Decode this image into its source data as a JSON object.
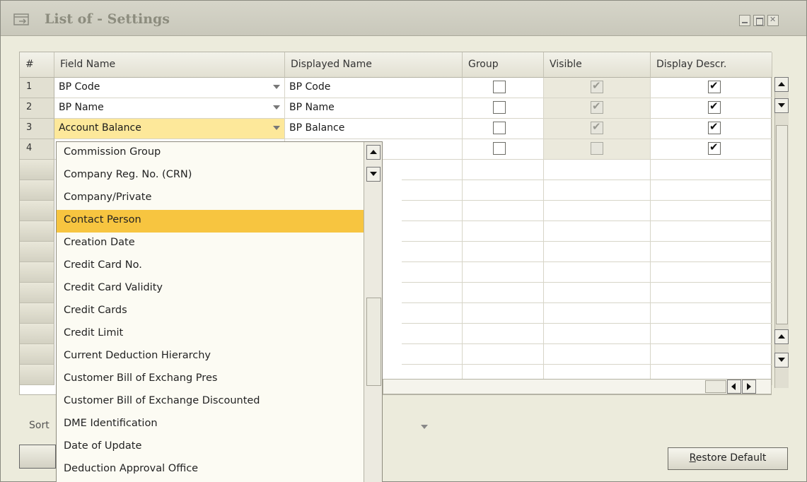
{
  "window": {
    "title": "List of - Settings"
  },
  "columns": [
    "#",
    "Field Name",
    "Displayed Name",
    "Group",
    "Visible",
    "Display Descr."
  ],
  "rows": [
    {
      "num": "1",
      "field": "BP Code",
      "displayed": "BP Code",
      "group": false,
      "visible": true,
      "descr": true
    },
    {
      "num": "2",
      "field": "BP Name",
      "displayed": "BP Name",
      "group": false,
      "visible": true,
      "descr": true
    },
    {
      "num": "3",
      "field": "Account Balance",
      "displayed": "BP Balance",
      "group": false,
      "visible": true,
      "descr": true
    },
    {
      "num": "4",
      "field": "",
      "displayed": "",
      "group": false,
      "visible": false,
      "descr": true
    }
  ],
  "dropdown": {
    "selected": "Contact Person",
    "items": [
      "Commission Group",
      "Company Reg. No. (CRN)",
      "Company/Private",
      "Contact Person",
      "Creation Date",
      "Credit Card  No.",
      "Credit Card Validity",
      "Credit Cards",
      "Credit Limit",
      "Current Deduction Hierarchy",
      "Customer Bill of Exchang Pres",
      "Customer Bill of Exchange Discounted",
      "DME Identification",
      "Date of Update",
      "Deduction Approval Office"
    ]
  },
  "sort": {
    "label": "Sort"
  },
  "buttons": {
    "restore_default": "Restore Default",
    "restore_prefix": "R",
    "restore_rest": "estore Default"
  },
  "colors": {
    "highlight": "#fde89a",
    "selected_item": "#f7c540"
  }
}
